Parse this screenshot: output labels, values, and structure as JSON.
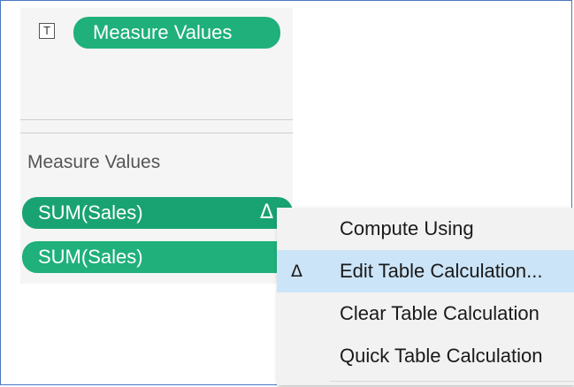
{
  "marks_card": {
    "text_mark_icon": "T",
    "measure_values_pill": "Measure Values"
  },
  "measure_values_section": {
    "label": "Measure Values",
    "pills": [
      {
        "label": "SUM(Sales)",
        "delta_icon": "Δ"
      },
      {
        "label": "SUM(Sales)"
      }
    ]
  },
  "context_menu": {
    "items": [
      {
        "label": "Compute Using"
      },
      {
        "label": "Edit Table Calculation...",
        "icon": "Δ",
        "highlighted": true
      },
      {
        "label": "Clear Table Calculation"
      },
      {
        "label": "Quick Table Calculation"
      }
    ]
  },
  "colors": {
    "pill_green": "#1fb07c",
    "pill_green_active": "#19a372",
    "menu_background": "#f2f2f2",
    "menu_highlight": "#cce4f7",
    "frame_border": "#4a78c2"
  },
  "icons": {
    "text_mark": "text-mark-icon",
    "table_calc": "delta-icon"
  }
}
